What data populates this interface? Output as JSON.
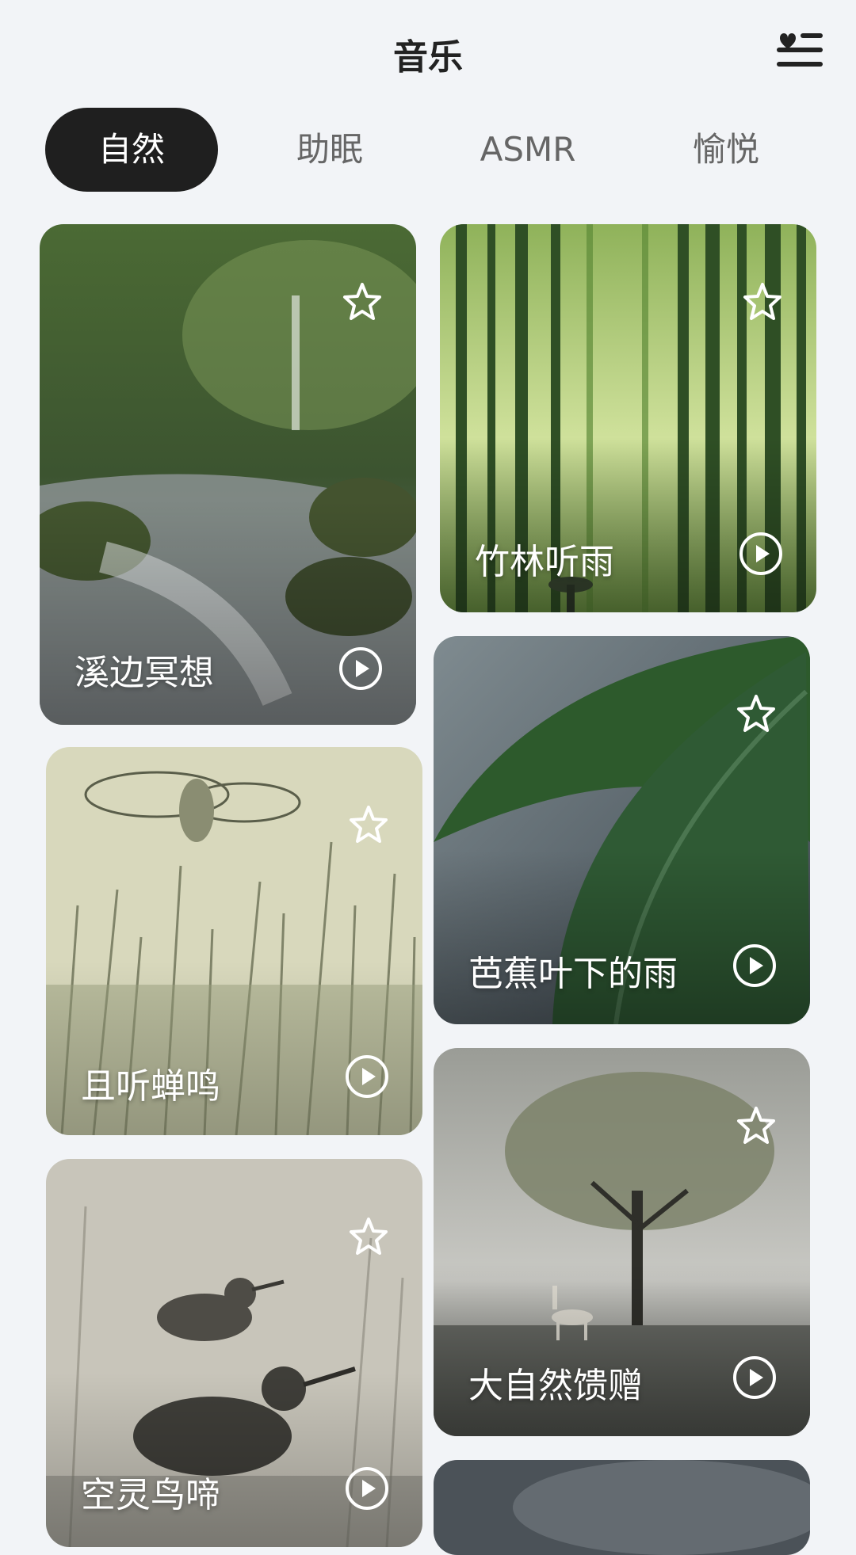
{
  "header": {
    "title": "音乐",
    "fav_list_icon": "heart-list-icon"
  },
  "tabs": [
    {
      "label": "自然",
      "active": true
    },
    {
      "label": "助眠",
      "active": false
    },
    {
      "label": "ASMR",
      "active": false
    },
    {
      "label": "愉悦",
      "active": false
    }
  ],
  "cards": [
    {
      "label": "溪边冥想",
      "star_icon": "star-outline-icon",
      "play_icon": "play-circle-icon"
    },
    {
      "label": "竹林听雨",
      "star_icon": "star-outline-icon",
      "play_icon": "play-circle-icon"
    },
    {
      "label": "芭蕉叶下的雨",
      "star_icon": "star-outline-icon",
      "play_icon": "play-circle-icon"
    },
    {
      "label": "且听蝉鸣",
      "star_icon": "star-outline-icon",
      "play_icon": "play-circle-icon"
    },
    {
      "label": "大自然馈赠",
      "star_icon": "star-outline-icon",
      "play_icon": "play-circle-icon"
    },
    {
      "label": "空灵鸟啼",
      "star_icon": "star-outline-icon",
      "play_icon": "play-circle-icon"
    }
  ]
}
